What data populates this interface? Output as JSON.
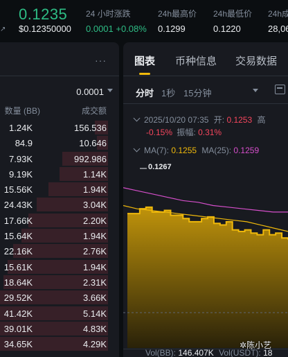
{
  "header": {
    "star_icon": "star-icon",
    "last_price": "0.1235",
    "last_price_fiat": "$0.12350000",
    "stats": [
      {
        "label": "24 小时涨跌",
        "value": "0.0001 +0.08%",
        "color": "#2ebd85"
      },
      {
        "label": "24h最高价",
        "value": "0.1299"
      },
      {
        "label": "24h最低价",
        "value": "0.1220"
      },
      {
        "label": "24h成",
        "value": "28,06"
      }
    ]
  },
  "orderbook": {
    "more_label": "···",
    "precision": "0.0001",
    "col_amount": "数量 (BB)",
    "col_volume": "成交额",
    "rows": [
      {
        "amount": "1.24K",
        "volume": "156.536",
        "depth": 0.12
      },
      {
        "amount": "84.9",
        "volume": "10.646",
        "depth": 0.1
      },
      {
        "amount": "7.93K",
        "volume": "992.986",
        "depth": 0.42
      },
      {
        "amount": "9.19K",
        "volume": "1.14K",
        "depth": 0.45
      },
      {
        "amount": "15.56K",
        "volume": "1.94K",
        "depth": 0.55
      },
      {
        "amount": "24.43K",
        "volume": "3.04K",
        "depth": 0.66
      },
      {
        "amount": "17.66K",
        "volume": "2.20K",
        "depth": 0.74
      },
      {
        "amount": "15.64K",
        "volume": "1.94K",
        "depth": 0.8
      },
      {
        "amount": "22.16K",
        "volume": "2.76K",
        "depth": 0.88
      },
      {
        "amount": "15.61K",
        "volume": "1.94K",
        "depth": 0.93
      },
      {
        "amount": "18.64K",
        "volume": "2.31K",
        "depth": 0.97
      },
      {
        "amount": "29.52K",
        "volume": "3.66K",
        "depth": 1.0
      },
      {
        "amount": "41.42K",
        "volume": "5.14K",
        "depth": 1.0
      },
      {
        "amount": "39.01K",
        "volume": "4.83K",
        "depth": 1.0
      },
      {
        "amount": "34.65K",
        "volume": "4.29K",
        "depth": 1.0
      }
    ]
  },
  "chart": {
    "tabs": [
      {
        "label": "图表",
        "active": true
      },
      {
        "label": "币种信息",
        "active": false
      },
      {
        "label": "交易数据",
        "active": false
      }
    ],
    "timeframes": [
      {
        "label": "分时",
        "active": true
      },
      {
        "label": "1秒",
        "active": false
      },
      {
        "label": "15分钟",
        "active": false
      }
    ],
    "calendar_icon": "calendar-icon",
    "ohlc": {
      "datetime": "2025/10/20 07:35",
      "open_label": "开:",
      "open_value": "0.1253",
      "high_label": "高",
      "change": "-0.15%",
      "amplitude_label": "振幅:",
      "amplitude": "0.31%"
    },
    "ma": {
      "ma7_label": "MA(7):",
      "ma7_value": "0.1255",
      "ma25_label": "MA(25):",
      "ma25_value": "0.1259"
    },
    "high_marker": "0.1267",
    "volume": {
      "label": "Vol(BB):",
      "value": "146.407K",
      "label2": "Vol(USDT):",
      "value2": "18"
    },
    "colors": {
      "price": "#f0b90b",
      "ma7": "#f0b90b",
      "ma25": "#d64fcb",
      "down": "#f6465d",
      "up": "#2ebd85"
    }
  },
  "chart_data": {
    "type": "area",
    "series": [
      {
        "values": [
          0.1263,
          0.1263,
          0.1266,
          0.1267,
          0.1264,
          0.1264,
          0.1265,
          0.1262,
          0.1262,
          0.126,
          0.1258,
          0.1258,
          0.126,
          0.1261,
          0.1257,
          0.1256,
          0.1258,
          0.1253,
          0.1252,
          0.1253,
          0.1251,
          0.125,
          0.1253,
          0.125,
          0.1251,
          0.1248,
          0.1247
        ]
      },
      {
        "values": [
          0.1268,
          0.1266,
          0.1265,
          0.1264,
          0.1263,
          0.1262,
          0.1261,
          0.126,
          0.1259,
          0.1258,
          0.1256,
          0.1254,
          0.1252
        ]
      },
      {
        "values": [
          0.1279,
          0.1277,
          0.1275,
          0.1273,
          0.1271,
          0.127,
          0.1268,
          0.1267,
          0.1266,
          0.1265,
          0.1264,
          0.1264
        ]
      }
    ]
  },
  "watermark": "陈小艺"
}
